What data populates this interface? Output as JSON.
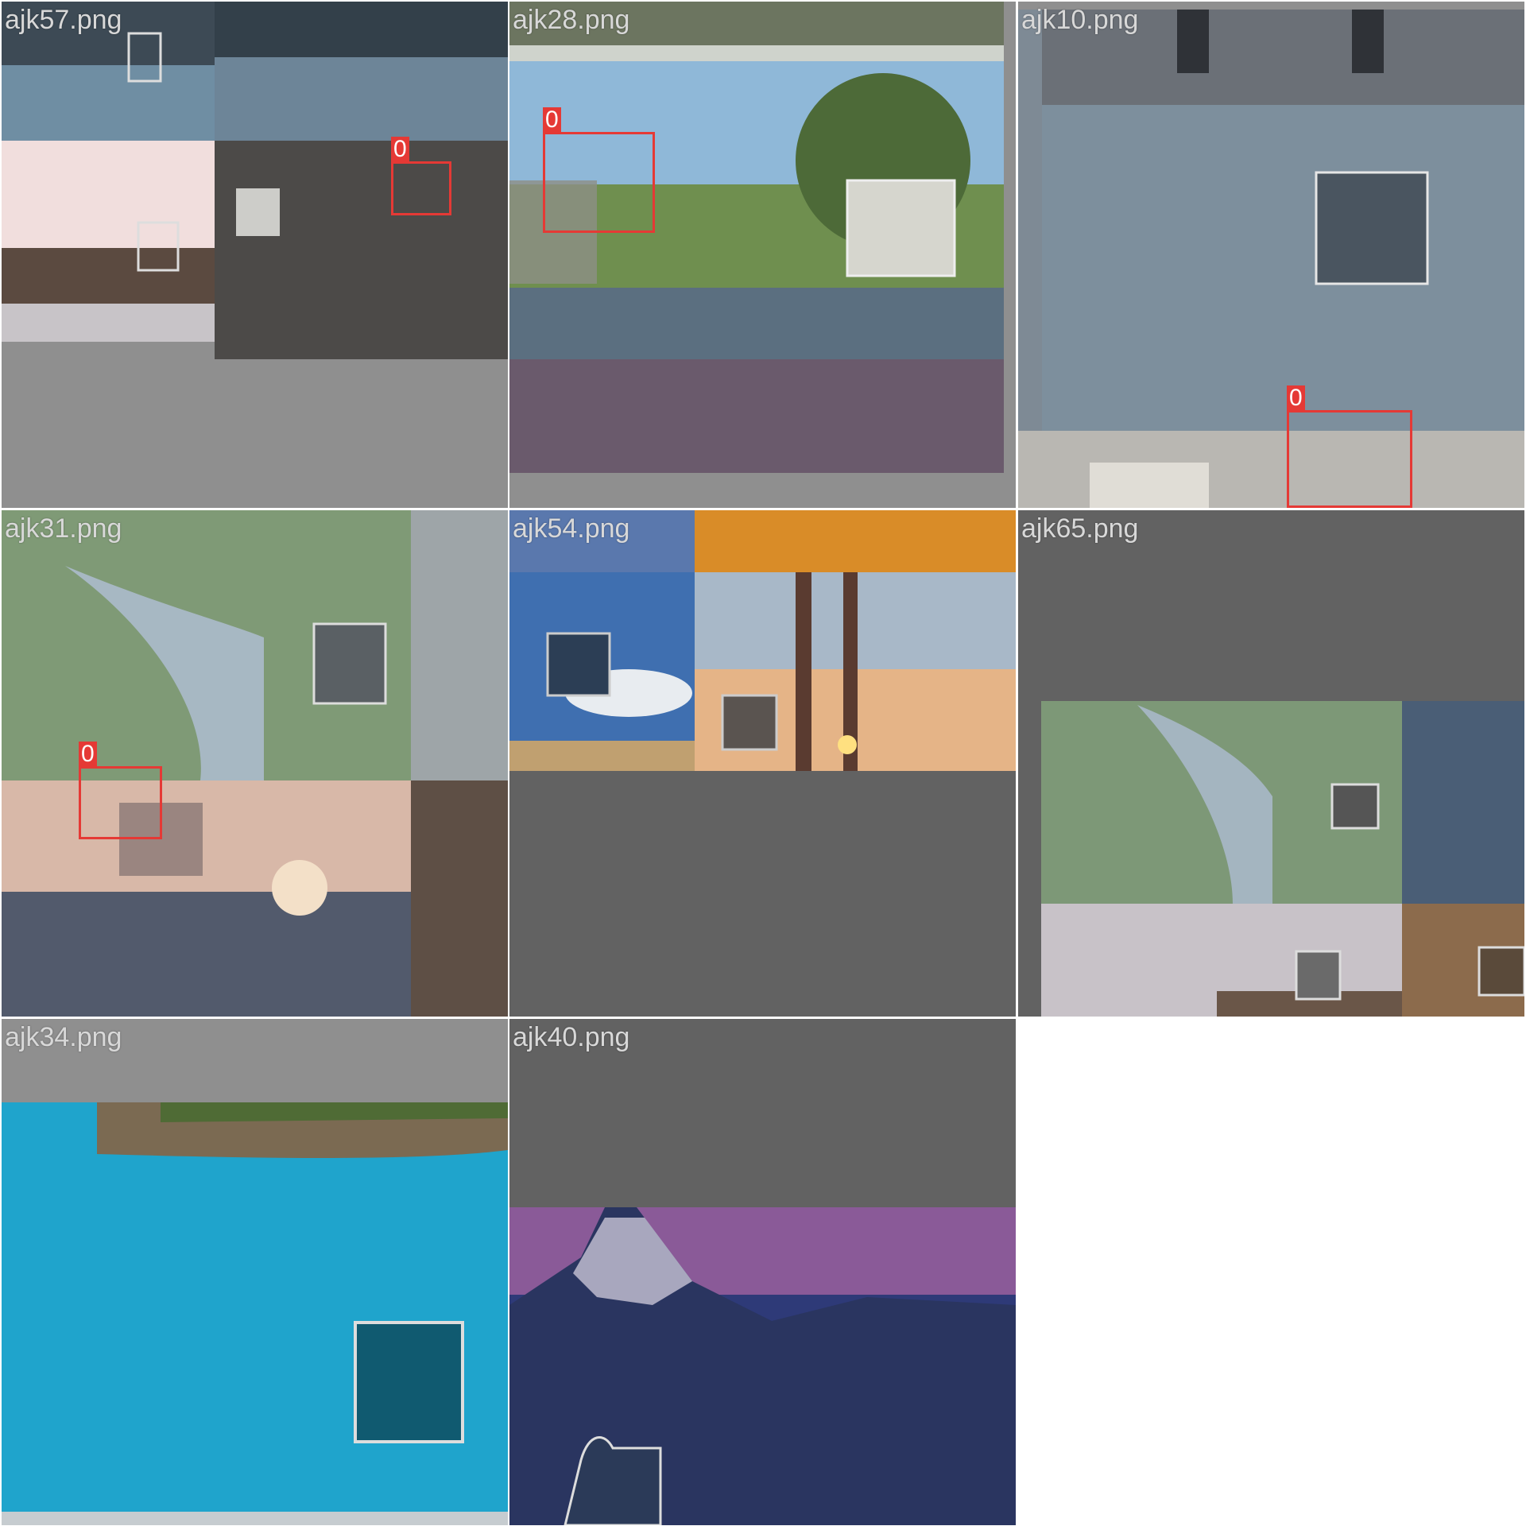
{
  "tiles": [
    {
      "filename": "ajk57.png",
      "boxes": [
        {
          "label": "0"
        }
      ]
    },
    {
      "filename": "ajk28.png",
      "boxes": [
        {
          "label": "0"
        }
      ]
    },
    {
      "filename": "ajk10.png",
      "boxes": [
        {
          "label": "0"
        }
      ]
    },
    {
      "filename": "ajk31.png",
      "boxes": [
        {
          "label": "0"
        }
      ]
    },
    {
      "filename": "ajk54.png",
      "boxes": []
    },
    {
      "filename": "ajk65.png",
      "boxes": []
    },
    {
      "filename": "ajk34.png",
      "boxes": []
    },
    {
      "filename": "ajk40.png",
      "boxes": []
    }
  ],
  "colors": {
    "box": "#e53935",
    "label_text": "#d8d8d8",
    "pad_light": "#8f8f8f",
    "pad_dark": "#626262"
  }
}
